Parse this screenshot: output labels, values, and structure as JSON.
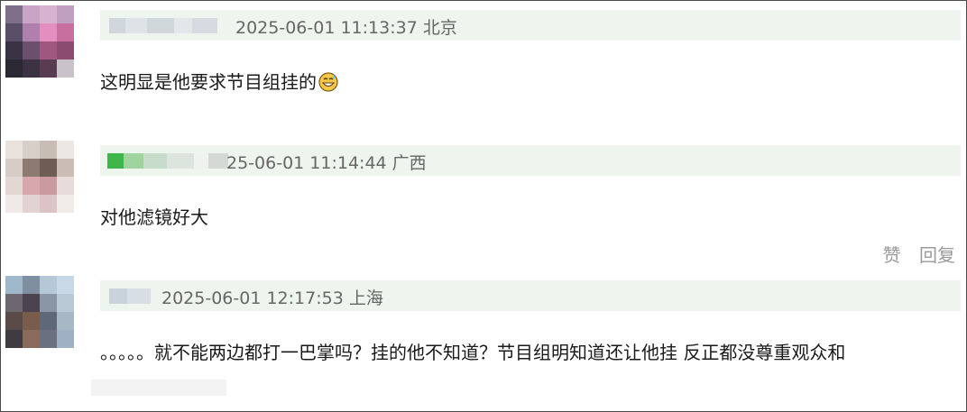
{
  "comments": [
    {
      "meta": "2025-06-01 11:13:37 北京",
      "text": "这明显是他要求节目组挂的",
      "emoji_icon": "grinning-sweat-emoji-icon"
    },
    {
      "meta": "25-06-01 11:14:44 广西",
      "text": "对他滤镜好大",
      "actions": {
        "like": "赞",
        "reply": "回复"
      }
    },
    {
      "meta": "2025-06-01 12:17:53 上海",
      "text": "。。。。。就不能两边都打一巴掌吗？挂的他不知道？节目组明知道还让他挂 反正都没尊重观众和"
    }
  ]
}
